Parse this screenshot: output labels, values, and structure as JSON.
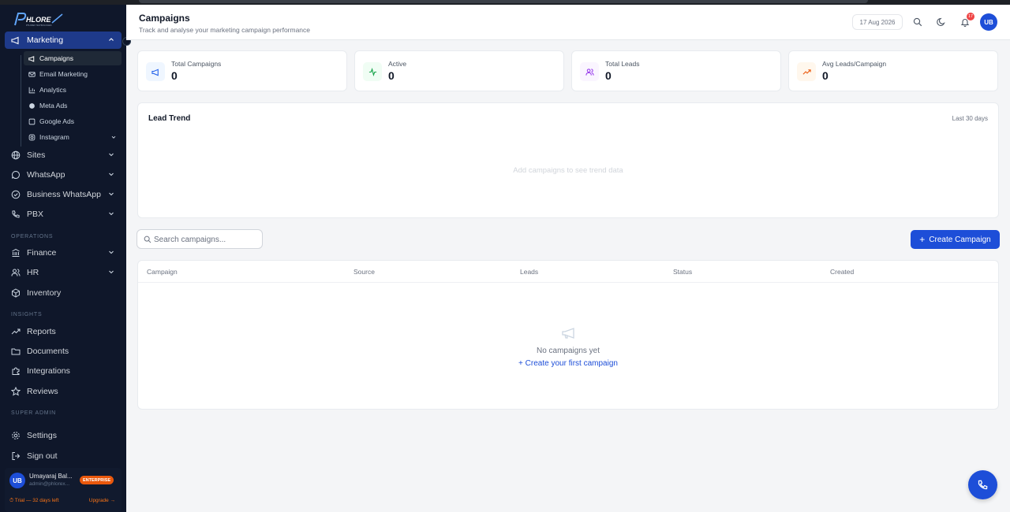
{
  "app": {
    "logo_text": "PHLORE"
  },
  "sidebar": {
    "marketing": {
      "label": "Marketing",
      "icon": "megaphone-icon"
    },
    "sub_items": [
      {
        "label": "Campaigns",
        "icon": "megaphone-icon"
      },
      {
        "label": "Email Marketing",
        "icon": "mail-icon"
      },
      {
        "label": "Analytics",
        "icon": "bar-chart-icon"
      },
      {
        "label": "Meta Ads",
        "icon": "circle-icon"
      },
      {
        "label": "Google Ads",
        "icon": "square-icon"
      },
      {
        "label": "Instagram",
        "icon": "camera-icon"
      }
    ],
    "items": [
      {
        "label": "Sites",
        "icon": "globe-icon"
      },
      {
        "label": "WhatsApp",
        "icon": "chat-icon"
      },
      {
        "label": "Business WhatsApp",
        "icon": "check-circle-icon"
      },
      {
        "label": "PBX",
        "icon": "phone-icon"
      }
    ],
    "operations_label": "OPERATIONS",
    "operations": [
      {
        "label": "Finance",
        "icon": "wallet-icon"
      },
      {
        "label": "HR",
        "icon": "users-icon"
      },
      {
        "label": "Inventory",
        "icon": "box-icon"
      }
    ],
    "insights_label": "INSIGHTS",
    "insights": [
      {
        "label": "Reports",
        "icon": "trend-icon"
      },
      {
        "label": "Documents",
        "icon": "folder-icon"
      },
      {
        "label": "Integrations",
        "icon": "puzzle-icon"
      },
      {
        "label": "Reviews",
        "icon": "star-icon"
      }
    ],
    "super_admin_label": "SUPER ADMIN",
    "settings": "Settings",
    "sign_out": "Sign out",
    "user": {
      "initials": "UB",
      "name": "Umayaraj Bal...",
      "email": "admin@phlorex...",
      "plan": "ENTERPRISE",
      "trial": "⏱ Trial — 32 days left",
      "upgrade": "Upgrade →"
    }
  },
  "header": {
    "title": "Campaigns",
    "subtitle": "Track and analyse your marketing campaign performance",
    "date": "17 Aug 2026",
    "notifications": "17",
    "avatar_initials": "UB"
  },
  "stats": [
    {
      "label": "Total Campaigns",
      "value": "0",
      "icon": "megaphone-icon",
      "color": "#3b82f6"
    },
    {
      "label": "Active",
      "value": "0",
      "icon": "activity-icon",
      "color": "#16a34a"
    },
    {
      "label": "Total Leads",
      "value": "0",
      "icon": "users-icon",
      "color": "#9333ea"
    },
    {
      "label": "Avg Leads/Campaign",
      "value": "0",
      "icon": "trend-up-icon",
      "color": "#ea580c"
    }
  ],
  "trend": {
    "title": "Lead Trend",
    "range": "Last 30 days",
    "empty": "Add campaigns to see trend data"
  },
  "search": {
    "placeholder": "Search campaigns..."
  },
  "create_button": "Create Campaign",
  "table": {
    "columns": [
      "Campaign",
      "Source",
      "Leads",
      "Status",
      "Created"
    ],
    "empty_text": "No campaigns yet",
    "empty_link": "+ Create your first campaign"
  },
  "colors": {
    "accent": "#1d4ed8",
    "sidebar_bg": "#0f172a"
  }
}
